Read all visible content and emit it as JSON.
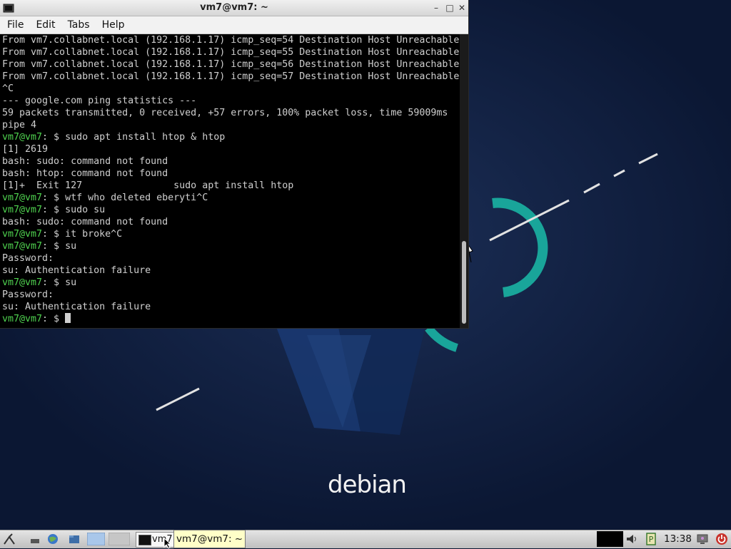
{
  "window": {
    "title": "vm7@vm7: ~",
    "menu": [
      "File",
      "Edit",
      "Tabs",
      "Help"
    ]
  },
  "terminal": {
    "lines": [
      {
        "prompt": "",
        "text": "From vm7.collabnet.local (192.168.1.17) icmp_seq=54 Destination Host Unreachable"
      },
      {
        "prompt": "",
        "text": "From vm7.collabnet.local (192.168.1.17) icmp_seq=55 Destination Host Unreachable"
      },
      {
        "prompt": "",
        "text": "From vm7.collabnet.local (192.168.1.17) icmp_seq=56 Destination Host Unreachable"
      },
      {
        "prompt": "",
        "text": "From vm7.collabnet.local (192.168.1.17) icmp_seq=57 Destination Host Unreachable"
      },
      {
        "prompt": "",
        "text": "^C"
      },
      {
        "prompt": "",
        "text": "--- google.com ping statistics ---"
      },
      {
        "prompt": "",
        "text": "59 packets transmitted, 0 received, +57 errors, 100% packet loss, time 59009ms"
      },
      {
        "prompt": "",
        "text": "pipe 4"
      },
      {
        "prompt": "vm7@vm7",
        "text": ": $ sudo apt install htop & htop"
      },
      {
        "prompt": "",
        "text": "[1] 2619"
      },
      {
        "prompt": "",
        "text": "bash: sudo: command not found"
      },
      {
        "prompt": "",
        "text": "bash: htop: command not found"
      },
      {
        "prompt": "",
        "text": "[1]+  Exit 127                sudo apt install htop"
      },
      {
        "prompt": "vm7@vm7",
        "text": ": $ wtf who deleted eberyti^C"
      },
      {
        "prompt": "vm7@vm7",
        "text": ": $ sudo su"
      },
      {
        "prompt": "",
        "text": "bash: sudo: command not found"
      },
      {
        "prompt": "vm7@vm7",
        "text": ": $ it broke^C"
      },
      {
        "prompt": "vm7@vm7",
        "text": ": $ su"
      },
      {
        "prompt": "",
        "text": "Password:"
      },
      {
        "prompt": "",
        "text": "su: Authentication failure"
      },
      {
        "prompt": "vm7@vm7",
        "text": ": $ su"
      },
      {
        "prompt": "",
        "text": "Password:"
      },
      {
        "prompt": "",
        "text": "su: Authentication failure"
      },
      {
        "prompt": "vm7@vm7",
        "text": ": $ ",
        "cursor": true
      }
    ]
  },
  "desktop": {
    "logo_text": "debian"
  },
  "taskbar": {
    "task_label": "vm7",
    "tooltip": "vm7@vm7: ~",
    "clock": "13:38",
    "icons": [
      "start-menu-icon",
      "show-desktop-icon",
      "file-manager-icon",
      "web-browser-icon",
      "screen-icon",
      "desktop-switcher-icon",
      "volume-icon",
      "clipboard-icon",
      "update-notifier-icon",
      "logout-icon"
    ]
  },
  "colors": {
    "prompt": "#4fd24f",
    "terminal_text": "#cfcfcf",
    "terminal_bg": "#000000",
    "wallpaper": "#0b1733",
    "accent_teal": "#19a59a"
  }
}
